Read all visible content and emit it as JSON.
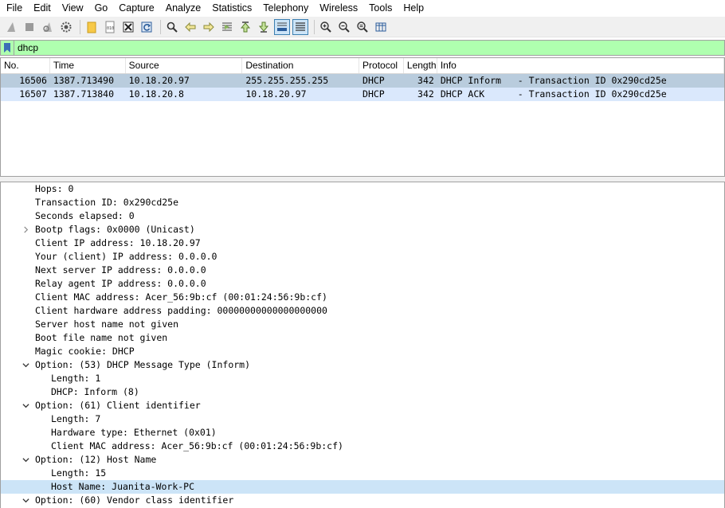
{
  "menu": [
    "File",
    "Edit",
    "View",
    "Go",
    "Capture",
    "Analyze",
    "Statistics",
    "Telephony",
    "Wireless",
    "Tools",
    "Help"
  ],
  "toolbar_icons": [
    "shark-fin-start-icon",
    "stop-square-icon",
    "shark-fin-restart-icon",
    "capture-options-gear-icon",
    "open-folder-icon",
    "save-binary-file-icon",
    "close-file-icon",
    "reload-icon",
    "find-magnifier-icon",
    "go-back-arrow-icon",
    "go-forward-arrow-icon",
    "go-to-packet-icon",
    "go-first-packet-icon",
    "go-last-packet-icon",
    "autoscroll-icon",
    "colorize-icon",
    "zoom-in-icon",
    "zoom-out-icon",
    "normal-size-icon",
    "resize-columns-icon"
  ],
  "filter": {
    "value": "dhcp"
  },
  "packet_list": {
    "columns": [
      "No.",
      "Time",
      "Source",
      "Destination",
      "Protocol",
      "Length",
      "Info"
    ],
    "rows": [
      {
        "no": "16506",
        "time": "1387.713490",
        "source": "10.18.20.97",
        "destination": "255.255.255.255",
        "protocol": "DHCP",
        "length": "342",
        "info": "DHCP Inform   - Transaction ID 0x290cd25e"
      },
      {
        "no": "16507",
        "time": "1387.713840",
        "source": "10.18.20.8",
        "destination": "10.18.20.97",
        "protocol": "DHCP",
        "length": "342",
        "info": "DHCP ACK      - Transaction ID 0x290cd25e"
      }
    ]
  },
  "details": [
    {
      "text": "Hops: 0",
      "level": 0,
      "arrow": ""
    },
    {
      "text": "Transaction ID: 0x290cd25e",
      "level": 0,
      "arrow": ""
    },
    {
      "text": "Seconds elapsed: 0",
      "level": 0,
      "arrow": ""
    },
    {
      "text": "Bootp flags: 0x0000 (Unicast)",
      "level": 0,
      "arrow": "right"
    },
    {
      "text": "Client IP address: 10.18.20.97",
      "level": 0,
      "arrow": ""
    },
    {
      "text": "Your (client) IP address: 0.0.0.0",
      "level": 0,
      "arrow": ""
    },
    {
      "text": "Next server IP address: 0.0.0.0",
      "level": 0,
      "arrow": ""
    },
    {
      "text": "Relay agent IP address: 0.0.0.0",
      "level": 0,
      "arrow": ""
    },
    {
      "text": "Client MAC address: Acer_56:9b:cf (00:01:24:56:9b:cf)",
      "level": 0,
      "arrow": ""
    },
    {
      "text": "Client hardware address padding: 00000000000000000000",
      "level": 0,
      "arrow": ""
    },
    {
      "text": "Server host name not given",
      "level": 0,
      "arrow": ""
    },
    {
      "text": "Boot file name not given",
      "level": 0,
      "arrow": ""
    },
    {
      "text": "Magic cookie: DHCP",
      "level": 0,
      "arrow": ""
    },
    {
      "text": "Option: (53) DHCP Message Type (Inform)",
      "level": 0,
      "arrow": "down"
    },
    {
      "text": "Length: 1",
      "level": 1,
      "arrow": ""
    },
    {
      "text": "DHCP: Inform (8)",
      "level": 1,
      "arrow": ""
    },
    {
      "text": "Option: (61) Client identifier",
      "level": 0,
      "arrow": "down"
    },
    {
      "text": "Length: 7",
      "level": 1,
      "arrow": ""
    },
    {
      "text": "Hardware type: Ethernet (0x01)",
      "level": 1,
      "arrow": ""
    },
    {
      "text": "Client MAC address: Acer_56:9b:cf (00:01:24:56:9b:cf)",
      "level": 1,
      "arrow": ""
    },
    {
      "text": "Option: (12) Host Name",
      "level": 0,
      "arrow": "down"
    },
    {
      "text": "Length: 15",
      "level": 1,
      "arrow": ""
    },
    {
      "text": "Host Name: Juanita-Work-PC",
      "level": 1,
      "arrow": "",
      "selected": true
    },
    {
      "text": "Option: (60) Vendor class identifier",
      "level": 0,
      "arrow": "down"
    }
  ],
  "colors": {
    "filter_bg": "#afffaf",
    "selected_row": "#b9ccdd",
    "dhcp_row": "#dae8fc",
    "selected_detail": "#cce4f7"
  }
}
